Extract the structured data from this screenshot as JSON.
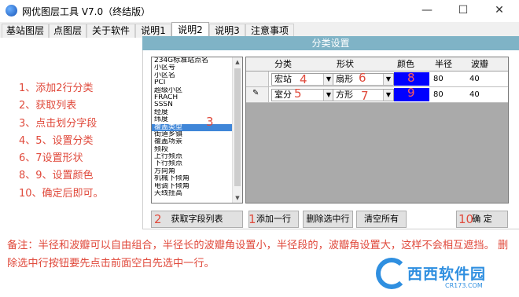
{
  "window": {
    "title": "网优图层工具 V7.0（终结版）",
    "minimize": "—",
    "maximize": "☐",
    "close": "✕"
  },
  "tabs": [
    {
      "label": "基站图层"
    },
    {
      "label": "点图层"
    },
    {
      "label": "关于软件"
    },
    {
      "label": "说明1"
    },
    {
      "label": "说明2",
      "active": true
    },
    {
      "label": "说明3"
    },
    {
      "label": "注意事项"
    }
  ],
  "group": {
    "title": "分类设置"
  },
  "steps": [
    "1、添加2行分类",
    "2、获取列表",
    "3、点击划分字段",
    "4、5、设置分类",
    "6、7设置形状",
    "8、9、设置颜色",
    "10、确定后即可。"
  ],
  "field_list": {
    "items": [
      "234G标准站点名",
      "小区号",
      "小区名",
      "PCI",
      "超级小区",
      "FRACH",
      "SSSN",
      "经度",
      "纬度",
      "覆盖类型",
      "街道乡镇",
      "覆盖场景",
      "频段",
      "上行频点",
      "下行频点",
      "方向角",
      "机械下倾角",
      "电调下倾角",
      "天线挂高"
    ],
    "selected_index": 9
  },
  "grid": {
    "columns": [
      "分类",
      "形状",
      "颜色",
      "半径",
      "波瓣"
    ],
    "rows": [
      {
        "category": "宏站",
        "shape": "扇形",
        "color": "#0000ff",
        "radius": "80",
        "lobe": "40",
        "marker": ""
      },
      {
        "category": "室分",
        "shape": "方形",
        "color": "#0000ff",
        "radius": "80",
        "lobe": "40",
        "marker": "✎"
      }
    ]
  },
  "buttons": {
    "get_fields": "获取字段列表",
    "add_row": "添加一行",
    "delete_row": "删除选中行",
    "clear_all": "清空所有",
    "ok": "确 定"
  },
  "annotations": {
    "n1": "1",
    "n2": "2",
    "n3": "3",
    "n4": "4",
    "n5": "5",
    "n6": "6",
    "n7": "7",
    "n8": "8",
    "n9": "9",
    "n10": "10"
  },
  "note": "备注：半径和波瓣可以自由组合，半径长的波瓣角设置小，半径段的，波瓣角设置大，这样不会相互遮挡。 删除选中行按钮要先点击前面空白先选中一行。",
  "watermark": {
    "name": "西西软件园",
    "url": "CR173.COM"
  },
  "colors": {
    "accent": "#7fb3c6",
    "annotation_red": "#e04a3c",
    "cell_blue": "#0000ff"
  }
}
